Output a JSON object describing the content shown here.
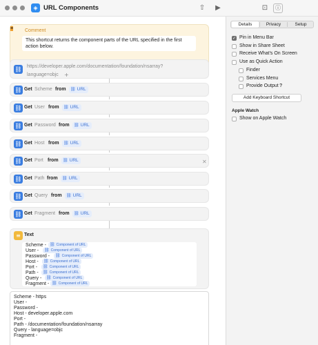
{
  "window": {
    "title": "URL Components",
    "app_icon": "layers-icon",
    "toolbar": [
      "share-icon",
      "run-icon",
      "library-icon",
      "info-icon"
    ]
  },
  "comment": {
    "label": "Comment",
    "text": "This shortcut returns the component parts of the URL specified in the first action below."
  },
  "url_action": {
    "value": "https://developer.apple.com/documentation/foundation/nsarray?",
    "value_line2": "language=objc"
  },
  "get_actions": [
    {
      "verb": "Get",
      "param": "Scheme",
      "from": "from",
      "token": "URL"
    },
    {
      "verb": "Get",
      "param": "User",
      "from": "from",
      "token": "URL"
    },
    {
      "verb": "Get",
      "param": "Password",
      "from": "from",
      "token": "URL"
    },
    {
      "verb": "Get",
      "param": "Host",
      "from": "from",
      "token": "URL"
    },
    {
      "verb": "Get",
      "param": "Port",
      "from": "from",
      "token": "URL"
    },
    {
      "verb": "Get",
      "param": "Path",
      "from": "from",
      "token": "URL"
    },
    {
      "verb": "Get",
      "param": "Query",
      "from": "from",
      "token": "URL"
    },
    {
      "verb": "Get",
      "param": "Fragment",
      "from": "from",
      "token": "URL"
    }
  ],
  "text_action": {
    "title": "Text",
    "token": "Component of URL",
    "lines": [
      "Scheme -",
      "User -",
      "Password -",
      "Host -",
      "Port -",
      "Path -",
      "Query -",
      "Fragment -"
    ]
  },
  "result": {
    "lines": [
      "Scheme - https",
      "User -",
      "Password -",
      "Host - developer.apple.com",
      "Port -",
      "Path - /documentation/foundation/nsarray",
      "Query - language=objc",
      "Fragment -"
    ]
  },
  "sidebar": {
    "tabs": [
      "Details",
      "Privacy",
      "Setup"
    ],
    "active_tab": "Details",
    "options": [
      {
        "label": "Pin in Menu Bar",
        "checked": true
      },
      {
        "label": "Show in Share Sheet",
        "checked": false
      },
      {
        "label": "Receive What's On Screen",
        "checked": false
      },
      {
        "label": "Use as Quick Action",
        "checked": false
      },
      {
        "label": "Finder",
        "checked": false
      },
      {
        "label": "Services Menu",
        "checked": false
      },
      {
        "label": "Provide Output",
        "checked": false
      }
    ],
    "help_mark": "?",
    "shortcut_button": "Add Keyboard Shortcut",
    "watch_section": "Apple Watch",
    "watch_option": {
      "label": "Show on Apple Watch",
      "checked": false
    }
  }
}
